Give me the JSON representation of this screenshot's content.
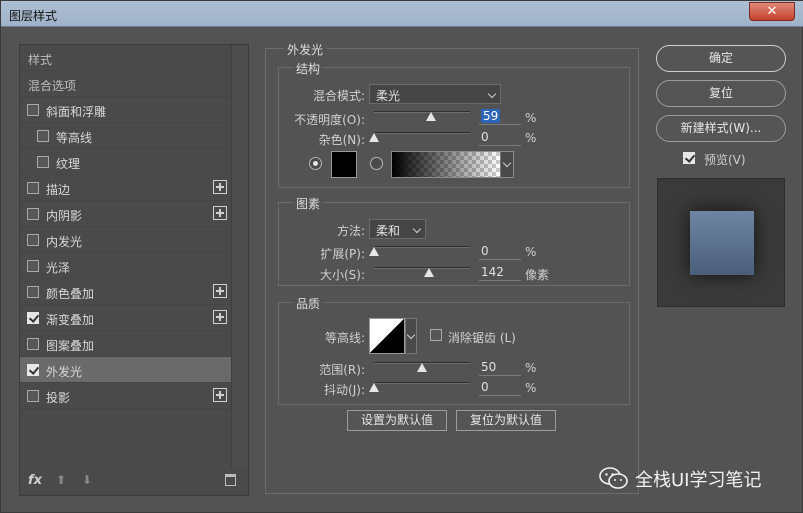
{
  "window": {
    "title": "图层样式",
    "close_glyph": "✕"
  },
  "left_panel": {
    "items": [
      {
        "label": "样式",
        "has_checkbox": false,
        "checked": false,
        "has_add": false,
        "selected": false,
        "indent": 0
      },
      {
        "label": "混合选项",
        "has_checkbox": false,
        "checked": false,
        "has_add": false,
        "selected": false,
        "indent": 0
      },
      {
        "label": "斜面和浮雕",
        "has_checkbox": true,
        "checked": false,
        "has_add": false,
        "selected": false,
        "indent": 0
      },
      {
        "label": "等高线",
        "has_checkbox": true,
        "checked": false,
        "has_add": false,
        "selected": false,
        "indent": 1
      },
      {
        "label": "纹理",
        "has_checkbox": true,
        "checked": false,
        "has_add": false,
        "selected": false,
        "indent": 1
      },
      {
        "label": "描边",
        "has_checkbox": true,
        "checked": false,
        "has_add": true,
        "selected": false,
        "indent": 0
      },
      {
        "label": "内阴影",
        "has_checkbox": true,
        "checked": false,
        "has_add": true,
        "selected": false,
        "indent": 0
      },
      {
        "label": "内发光",
        "has_checkbox": true,
        "checked": false,
        "has_add": false,
        "selected": false,
        "indent": 0
      },
      {
        "label": "光泽",
        "has_checkbox": true,
        "checked": false,
        "has_add": false,
        "selected": false,
        "indent": 0
      },
      {
        "label": "颜色叠加",
        "has_checkbox": true,
        "checked": false,
        "has_add": true,
        "selected": false,
        "indent": 0
      },
      {
        "label": "渐变叠加",
        "has_checkbox": true,
        "checked": true,
        "has_add": true,
        "selected": false,
        "indent": 0
      },
      {
        "label": "图案叠加",
        "has_checkbox": true,
        "checked": false,
        "has_add": false,
        "selected": false,
        "indent": 0
      },
      {
        "label": "外发光",
        "has_checkbox": true,
        "checked": true,
        "has_add": false,
        "selected": true,
        "indent": 0
      },
      {
        "label": "投影",
        "has_checkbox": true,
        "checked": false,
        "has_add": true,
        "selected": false,
        "indent": 0
      }
    ],
    "bottom": {
      "fx": "fx",
      "up_glyph": "⬆",
      "down_glyph": "⬇"
    }
  },
  "outer_glow": {
    "title": "外发光",
    "structure": {
      "title": "结构",
      "blend_mode_label": "混合模式:",
      "blend_mode_value": "柔光",
      "opacity_label": "不透明度(O):",
      "opacity_value": "59",
      "opacity_fraction": 0.59,
      "noise_label": "杂色(N):",
      "noise_value": "0",
      "noise_fraction": 0.0,
      "percent": "%",
      "color": "#000000"
    },
    "elements": {
      "title": "图素",
      "technique_label": "方法:",
      "technique_value": "柔和",
      "spread_label": "扩展(P):",
      "spread_value": "0",
      "spread_fraction": 0.0,
      "size_label": "大小(S):",
      "size_value": "142",
      "size_fraction": 0.57,
      "percent": "%",
      "pixel_unit": "像素"
    },
    "quality": {
      "title": "品质",
      "contour_label": "等高线:",
      "antialias_label": "消除锯齿 (L)",
      "range_label": "范围(R):",
      "range_value": "50",
      "range_fraction": 0.5,
      "jitter_label": "抖动(J):",
      "jitter_value": "0",
      "jitter_fraction": 0.0,
      "percent": "%"
    },
    "make_default": "设置为默认值",
    "reset_default": "复位为默认值"
  },
  "right_panel": {
    "ok": "确定",
    "reset": "复位",
    "new_style": "新建样式(W)...",
    "preview_label": "预览(V)",
    "preview_checked": true
  },
  "watermark": {
    "text": "全栈UI学习笔记",
    "icon": "wechat-icon"
  },
  "colors": {
    "accent_selection": "#2d66b8",
    "dialog_bg": "#535353",
    "title_bar": "#aebfd3",
    "close_button": "#c6402c"
  }
}
